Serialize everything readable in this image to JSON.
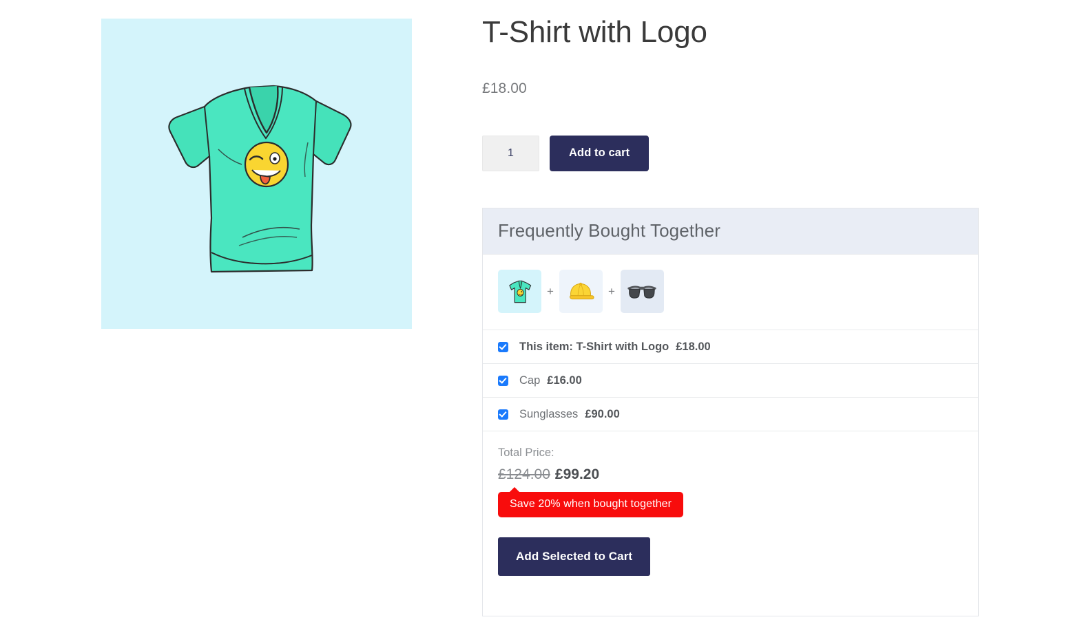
{
  "product": {
    "title": "T-Shirt with Logo",
    "price": "£18.00",
    "image_alt": "tshirt-with-winking-emoji",
    "image_bg": "#d4f4fb"
  },
  "cart_form": {
    "quantity_value": "1",
    "quantity_placeholder": "1",
    "add_to_cart_label": "Add to cart"
  },
  "fbt": {
    "header_title": "Frequently Bought Together",
    "plus_symbol": "+",
    "thumbnails": [
      {
        "name": "thumbnail-tshirt",
        "icon": "tshirt-icon"
      },
      {
        "name": "thumbnail-cap",
        "icon": "cap-icon"
      },
      {
        "name": "thumbnail-sunglasses",
        "icon": "sunglasses-icon"
      }
    ],
    "items": [
      {
        "label": "This item: T-Shirt with Logo",
        "price": "£18.00",
        "checked": true,
        "is_this_item": true
      },
      {
        "label": "Cap",
        "price": "£16.00",
        "checked": true,
        "is_this_item": false
      },
      {
        "label": "Sunglasses",
        "price": "£90.00",
        "checked": true,
        "is_this_item": false
      }
    ],
    "total_label": "Total Price:",
    "total_old_price": "£124.00",
    "total_new_price": "£99.20",
    "save_badge": "Save 20% when bought together",
    "add_selected_label": "Add Selected to Cart"
  },
  "colors": {
    "accent_navy": "#2c2e5c",
    "checkbox_blue": "#1a7afc",
    "badge_red": "#f80c0c",
    "panel_header_bg": "#e9edf5",
    "panel_border": "#e4e6ea"
  }
}
